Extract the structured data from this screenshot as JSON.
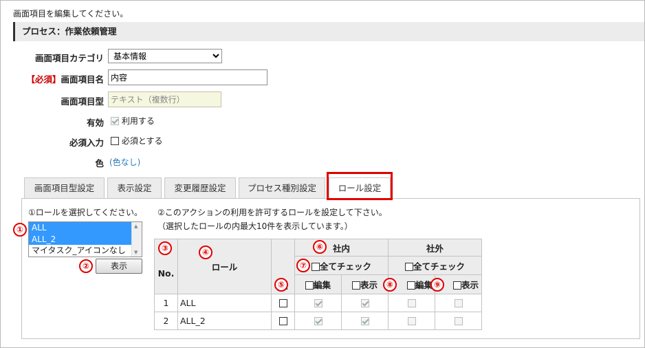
{
  "header": {
    "instruction": "画面項目を編集してください。",
    "process": "プロセス：作業依頼管理"
  },
  "form": {
    "category_label": "画面項目カテゴリ",
    "category_value": "基本情報",
    "required_tag": "【必須】",
    "name_label": "画面項目名",
    "name_value": "内容",
    "type_label": "画面項目型",
    "type_value": "テキスト（複数行）",
    "enabled_label": "有効",
    "enabled_text": "利用する",
    "required_label": "必須入力",
    "required_text": "必須とする",
    "color_label": "色",
    "color_value": "(色なし)"
  },
  "tabs": [
    "画面項目型設定",
    "表示設定",
    "変更履歴設定",
    "プロセス種別設定",
    "ロール設定"
  ],
  "roles_panel": {
    "select_prompt": "①ロールを選択してください。",
    "role_list": [
      "ALL",
      "ALL_2",
      "マイタスク_アイコンなし"
    ],
    "show_button": "表示",
    "action_prompt_1": "②このアクションの利用を許可するロールを設定して下さい。",
    "action_prompt_2": "（選択したロールの内最大10件を表示しています。）"
  },
  "table": {
    "col_no": "No.",
    "col_role": "ロール",
    "internal": "社内",
    "external": "社外",
    "check_all": "全てチェック",
    "edit": "編集",
    "display": "表示",
    "rows": [
      {
        "no": "1",
        "role": "ALL",
        "allow": false,
        "int_edit": true,
        "int_display": true,
        "ext_edit": false,
        "ext_display": false
      },
      {
        "no": "2",
        "role": "ALL_2",
        "allow": false,
        "int_edit": true,
        "int_display": true,
        "ext_edit": false,
        "ext_display": false
      }
    ]
  },
  "markers": [
    "①",
    "②",
    "③",
    "④",
    "⑤",
    "⑥",
    "⑦",
    "⑧",
    "⑨"
  ],
  "colors": {
    "marker_red": "#e00000",
    "selection_blue": "#3399ff",
    "link_blue": "#2a7ab8"
  }
}
